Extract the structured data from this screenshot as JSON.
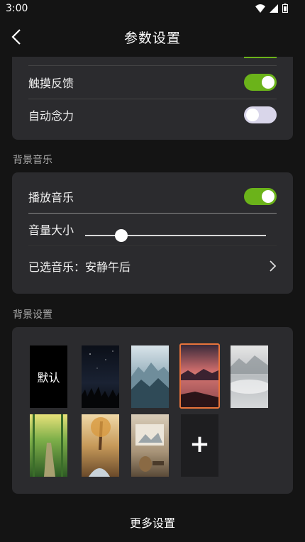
{
  "status_bar": {
    "time": "3:00"
  },
  "header": {
    "title": "参数设置"
  },
  "general": {
    "rows": [
      {
        "label": "触摸反馈",
        "enabled": true
      },
      {
        "label": "自动念力",
        "enabled": false
      }
    ]
  },
  "music": {
    "section_title": "背景音乐",
    "play_label": "播放音乐",
    "play_enabled": true,
    "volume_label": "音量大小",
    "volume_level": 0.2,
    "selected_music_text": "已选音乐：安静午后"
  },
  "background": {
    "section_title": "背景设置",
    "default_label": "默认",
    "selected_index": 3,
    "add_label": "+"
  },
  "footer": {
    "more_label": "更多设置"
  },
  "colors": {
    "accent_green": "#6bb31a",
    "selection_orange": "#e8743b",
    "card_bg": "#2b2b2e"
  }
}
